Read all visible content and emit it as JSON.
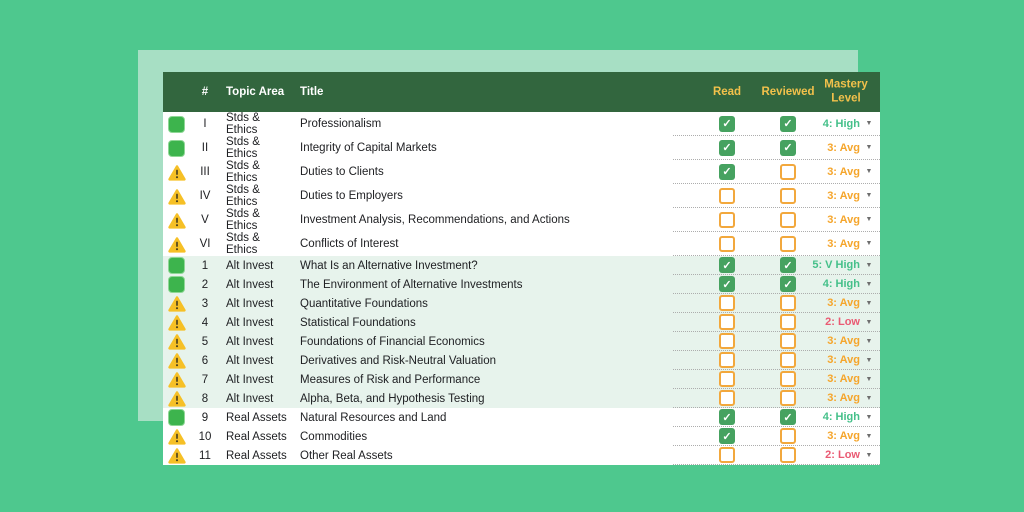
{
  "page": {
    "background_color": "#4ec88e",
    "panel_color": "#a7dfc4",
    "header_bg_color": "#32663e",
    "header_accent_color": "#f2c14b",
    "section_tint_color": "#e7f3ec",
    "mastery_colors": {
      "high": "#45c08a",
      "avg": "#f5a52b",
      "low": "#ea5a73"
    },
    "checkbox_colors": {
      "checked": "#46a260",
      "unchecked_border": "#f2a83d"
    },
    "status_icons": {
      "done": "check-icon",
      "warn": "warning-icon"
    }
  },
  "table": {
    "header": {
      "num": "#",
      "topic": "Topic Area",
      "title": "Title",
      "read": "Read",
      "reviewed": "Reviewed",
      "mastery": "Mastery Level"
    },
    "rows": [
      {
        "status": "done",
        "num": "I",
        "topic": "Stds & Ethics",
        "title": "Professionalism",
        "read": true,
        "reviewed": true,
        "mastery": "4: High",
        "level": "high",
        "tinted": false
      },
      {
        "status": "done",
        "num": "II",
        "topic": "Stds & Ethics",
        "title": "Integrity of Capital Markets",
        "read": true,
        "reviewed": true,
        "mastery": "3: Avg",
        "level": "avg",
        "tinted": false
      },
      {
        "status": "warn",
        "num": "III",
        "topic": "Stds & Ethics",
        "title": "Duties to Clients",
        "read": true,
        "reviewed": false,
        "mastery": "3: Avg",
        "level": "avg",
        "tinted": false
      },
      {
        "status": "warn",
        "num": "IV",
        "topic": "Stds & Ethics",
        "title": "Duties to Employers",
        "read": false,
        "reviewed": false,
        "mastery": "3: Avg",
        "level": "avg",
        "tinted": false
      },
      {
        "status": "warn",
        "num": "V",
        "topic": "Stds & Ethics",
        "title": "Investment Analysis, Recommendations, and Actions",
        "read": false,
        "reviewed": false,
        "mastery": "3: Avg",
        "level": "avg",
        "tinted": false
      },
      {
        "status": "warn",
        "num": "VI",
        "topic": "Stds & Ethics",
        "title": "Conflicts of Interest",
        "read": false,
        "reviewed": false,
        "mastery": "3: Avg",
        "level": "avg",
        "tinted": false
      },
      {
        "status": "done",
        "num": "1",
        "topic": "Alt Invest",
        "title": "What Is an Alternative Investment?",
        "read": true,
        "reviewed": true,
        "mastery": "5: V High",
        "level": "high",
        "tinted": true
      },
      {
        "status": "done",
        "num": "2",
        "topic": "Alt Invest",
        "title": "The Environment of Alternative Investments",
        "read": true,
        "reviewed": true,
        "mastery": "4: High",
        "level": "high",
        "tinted": true
      },
      {
        "status": "warn",
        "num": "3",
        "topic": "Alt Invest",
        "title": "Quantitative Foundations",
        "read": false,
        "reviewed": false,
        "mastery": "3: Avg",
        "level": "avg",
        "tinted": true
      },
      {
        "status": "warn",
        "num": "4",
        "topic": "Alt Invest",
        "title": "Statistical Foundations",
        "read": false,
        "reviewed": false,
        "mastery": "2: Low",
        "level": "low",
        "tinted": true
      },
      {
        "status": "warn",
        "num": "5",
        "topic": "Alt Invest",
        "title": "Foundations of Financial Economics",
        "read": false,
        "reviewed": false,
        "mastery": "3: Avg",
        "level": "avg",
        "tinted": true
      },
      {
        "status": "warn",
        "num": "6",
        "topic": "Alt Invest",
        "title": "Derivatives and Risk-Neutral Valuation",
        "read": false,
        "reviewed": false,
        "mastery": "3: Avg",
        "level": "avg",
        "tinted": true
      },
      {
        "status": "warn",
        "num": "7",
        "topic": "Alt Invest",
        "title": "Measures of Risk and Performance",
        "read": false,
        "reviewed": false,
        "mastery": "3: Avg",
        "level": "avg",
        "tinted": true
      },
      {
        "status": "warn",
        "num": "8",
        "topic": "Alt Invest",
        "title": "Alpha, Beta, and Hypothesis Testing",
        "read": false,
        "reviewed": false,
        "mastery": "3: Avg",
        "level": "avg",
        "tinted": true
      },
      {
        "status": "done",
        "num": "9",
        "topic": "Real Assets",
        "title": "Natural Resources and Land",
        "read": true,
        "reviewed": true,
        "mastery": "4: High",
        "level": "high",
        "tinted": false
      },
      {
        "status": "warn",
        "num": "10",
        "topic": "Real Assets",
        "title": "Commodities",
        "read": true,
        "reviewed": false,
        "mastery": "3: Avg",
        "level": "avg",
        "tinted": false
      },
      {
        "status": "warn",
        "num": "11",
        "topic": "Real Assets",
        "title": "Other Real Assets",
        "read": false,
        "reviewed": false,
        "mastery": "2: Low",
        "level": "low",
        "tinted": false
      }
    ]
  }
}
